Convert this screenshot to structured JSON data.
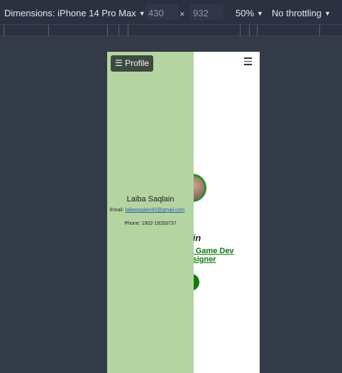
{
  "toolbar": {
    "dimensions_label": "Dimensions: iPhone 14 Pro Max",
    "width_value": "430",
    "times_symbol": "×",
    "height_value": "932",
    "zoom": "50%",
    "throttling": "No throttling"
  },
  "sidebar": {
    "toggle_label": "☰ Profile",
    "name": "Laiba Saqlain",
    "email_label": "Email:",
    "email": "laibasaqlain92@gmail.com",
    "phone": "Phone: 1902-19293737"
  },
  "hero": {
    "name_visible": "Saqlain",
    "tagline_line1": "lent | Game Dev",
    "tagline_line2": "X Designer"
  }
}
